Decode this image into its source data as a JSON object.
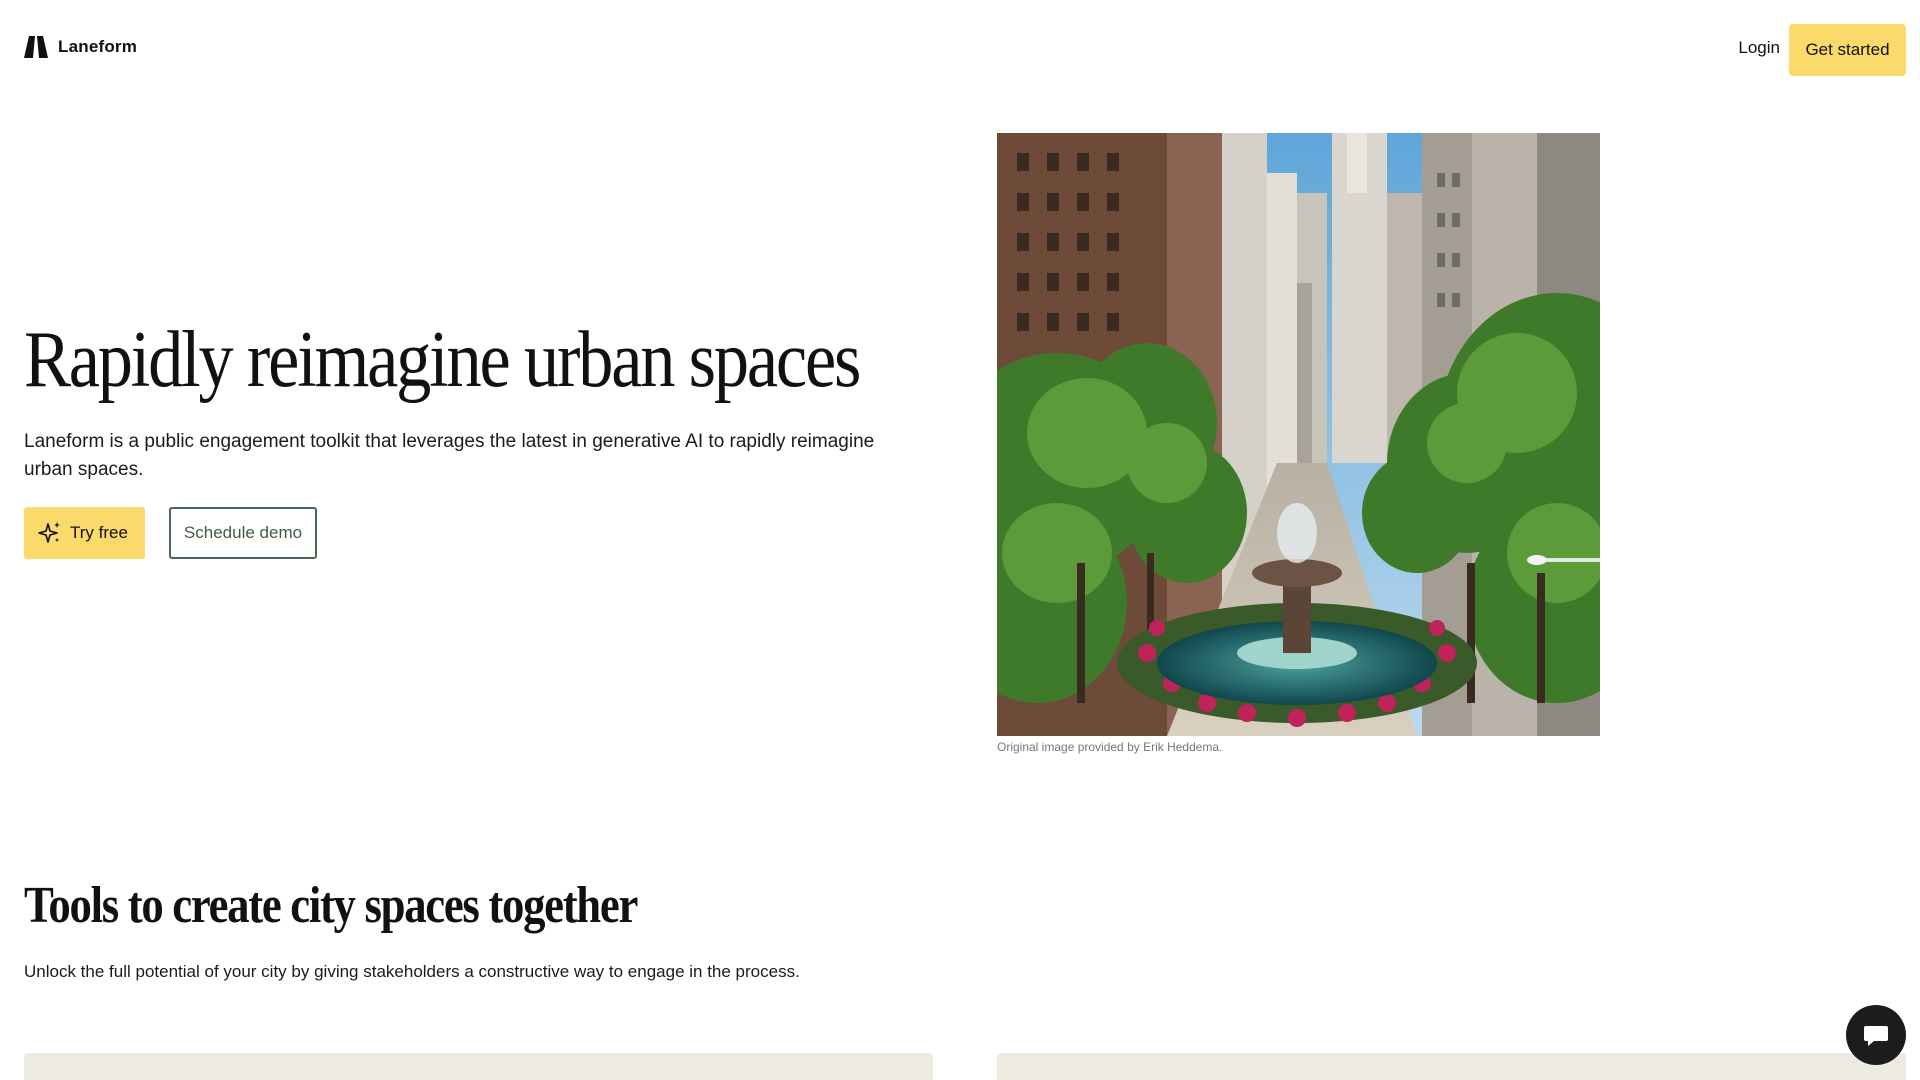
{
  "brand": {
    "name": "Laneform",
    "accent_color": "#fbd96b",
    "green_color": "#4a6a4f"
  },
  "nav": {
    "login_label": "Login",
    "get_started_label": "Get started"
  },
  "hero": {
    "title": "Rapidly reimagine urban spaces",
    "subtitle": "Laneform is a public engagement toolkit that leverages the latest in generative AI to rapidly reimagine urban spaces.",
    "try_label": "Try free",
    "try_icon": "sparkle-icon",
    "demo_label": "Schedule demo",
    "image_caption": "Original image provided by Erik Heddema."
  },
  "section": {
    "title": "Tools to create city spaces together",
    "subtitle": "Unlock the full potential of your city by giving stakeholders a constructive way to engage in the process."
  },
  "chat": {
    "icon": "chat-bubble-icon"
  }
}
